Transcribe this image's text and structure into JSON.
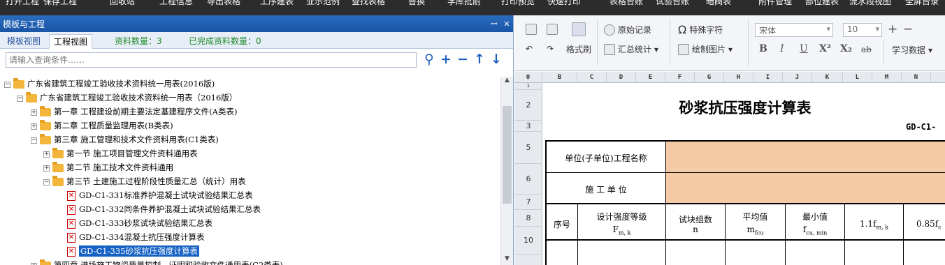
{
  "menubar": {
    "items": [
      "打开工程",
      "保存工程",
      "回收站",
      "工程信息",
      "导出表格",
      "工序建表",
      "业示范例",
      "查找表格",
      "替换",
      "学库批耐",
      "打印预览",
      "快速打印",
      "表格台账",
      "试验台账",
      "暗阀表",
      "附件管理",
      "部位建表",
      "流水段视图",
      "全屏台录"
    ]
  },
  "left_panel": {
    "title": "模板与工程",
    "pin": "ꟷ",
    "close": "✕",
    "tabs": {
      "template_view": "模板视图",
      "project_view": "工程视图",
      "doc_count": "资料数量：3",
      "done_count": "已完成资料数量：0"
    },
    "search": {
      "placeholder": "请输入查询条件……"
    },
    "tree": [
      {
        "label": "广东省建筑工程竣工验收技术资料统一用表(2016版)",
        "type": "folder",
        "toggle": "−"
      },
      {
        "label": "广东省建筑工程竣工验收技术资料统一用表（2016版）",
        "type": "folder",
        "toggle": "−"
      },
      {
        "label": "第一章 工程建设前期主要法定基建程序文件(A类表)",
        "type": "folder",
        "toggle": "+"
      },
      {
        "label": "第二章 工程质量监理用表(B类表)",
        "type": "folder",
        "toggle": "+"
      },
      {
        "label": "第三章 施工管理和技术文件资料用表(C1类表)",
        "type": "folder",
        "toggle": "−"
      },
      {
        "label": "第一节 施工项目管理文件资料通用表",
        "type": "folder",
        "toggle": "+"
      },
      {
        "label": "第二节 施工技术文件资料通用",
        "type": "folder",
        "toggle": "+"
      },
      {
        "label": "第三节 土建施工过程阶段性质量汇总（统计）用表",
        "type": "folder",
        "toggle": "−"
      },
      {
        "label": "GD-C1-331标准养护混凝土试块试验结果汇总表",
        "type": "doc"
      },
      {
        "label": "GD-C1-332同条件养护混凝土试块试验结果汇总表",
        "type": "doc"
      },
      {
        "label": "GD-C1-333砂浆试块试验结果汇总表",
        "type": "doc"
      },
      {
        "label": "GD-C1-334混凝土抗压强度计算表",
        "type": "doc"
      },
      {
        "label": "GD-C1-335砂浆抗压强度计算表",
        "type": "doc",
        "selected": true
      },
      {
        "label": "第四章 进场施工物资质量控制、证明和验收文件通用表(C2类表)",
        "type": "folder",
        "toggle": "+"
      }
    ]
  },
  "toolbar": {
    "original_record": "原始记录",
    "special_char": "特殊字符",
    "format_brush": "格式刷",
    "summary_stats": "汇总统计",
    "draw_image": "绘制图片",
    "font_name": "宋体",
    "font_size": "10",
    "learn_data": "学习数据",
    "bold": "B",
    "italic": "I",
    "underline": "U",
    "superscript": "X²",
    "subscript": "X₂",
    "strike": "ab"
  },
  "sheet": {
    "columns": [
      "0",
      "B",
      "C",
      "D",
      "E",
      "F",
      "G",
      "H",
      "I",
      "J",
      "K",
      "L",
      "M",
      "N"
    ],
    "rows": [
      "1",
      "2",
      "3",
      "5",
      "6",
      "7",
      "8",
      "10"
    ],
    "title": "砂浆抗压强度计算表",
    "code": "GD-C1-",
    "unit_label": "单位(子单位)工程名称",
    "construction_unit": "施 工 单 位",
    "headers": {
      "seq": "序号",
      "grade": "设计强度等级",
      "grade_sym": "F",
      "grade_sub": "m, k",
      "groups": "试块组数",
      "groups_sym": "n",
      "avg": "平均值",
      "avg_sym": "m",
      "avg_sub": "fcu",
      "min": "最小值",
      "min_sym": "f",
      "min_sub": "cu, min",
      "c11": "1.1f",
      "c11_sub": "m, k",
      "c085": "0.85f",
      "c085_sub": "c"
    }
  }
}
